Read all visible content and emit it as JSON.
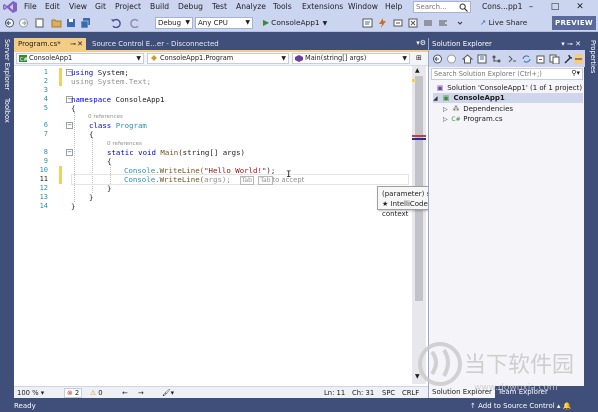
{
  "menu": {
    "items": [
      "File",
      "Edit",
      "View",
      "Git",
      "Project",
      "Build",
      "Debug",
      "Test",
      "Analyze",
      "Tools",
      "Extensions",
      "Window",
      "Help"
    ],
    "search_placeholder": "Search...",
    "solution_title": "Cons...pp1"
  },
  "toolbar": {
    "config": "Debug",
    "platform": "Any CPU",
    "start_label": "ConsoleApp1",
    "live_share": "Live Share",
    "preview": "PREVIEW"
  },
  "side_strip": {
    "left": [
      "Server Explorer",
      "Toolbox"
    ],
    "right": [
      "Properties"
    ]
  },
  "tabs": [
    {
      "label": "Program.cs*",
      "active": true
    },
    {
      "label": "Source Control E...er - Disconnected",
      "active": false
    }
  ],
  "nav": {
    "project": "ConsoleApp1",
    "class": "ConsoleApp1.Program",
    "member": "Main(string[] args)"
  },
  "code": {
    "line_numbers": [
      "1",
      "2",
      "3",
      "4",
      "5",
      "6",
      "7",
      "8",
      "9",
      "10",
      "11",
      "12",
      "13",
      "14"
    ],
    "refs_label": "0 references",
    "l1_kw": "using",
    "l1_rest": " System;",
    "l2": "using System.Text;",
    "l4_kw": "namespace",
    "l4_rest": " ConsoleApp1",
    "l5": "{",
    "l6_kw": "class",
    "l6_type": "Program",
    "l7": "{",
    "l8_kw1": "static",
    "l8_kw2": "void",
    "l8_meth": "Main",
    "l8_rest": "(string[] args)",
    "l9": "{",
    "l10_type": "Console",
    "l10_meth": ".WriteLine(",
    "l10_str": "\"Hello World!\"",
    "l10_end": ");",
    "l11_type": "Console",
    "l11_meth": ".WriteLine(",
    "l11_gray": "args);",
    "tab_hint_1": "Tab",
    "tab_hint_2": "Tab",
    "tab_hint_rest": "to accept",
    "l12": "}",
    "l13": "}",
    "l14": "}"
  },
  "tooltip": {
    "line1": "(parameter) string[] args",
    "line2": "★  IntelliCode suggestion based on this context"
  },
  "editor_status": {
    "zoom": "100 %",
    "errors": "2",
    "warnings": "0",
    "position": "Ln: 11",
    "column": "Ch: 31",
    "spacing": "SPC",
    "line_ending": "CRLF"
  },
  "solution_explorer": {
    "title": "Solution Explorer",
    "search_placeholder": "Search Solution Explorer (Ctrl+;)",
    "solution": "Solution 'ConsoleApp1' (1 of 1 project)",
    "project": "ConsoleApp1",
    "dependencies": "Dependencies",
    "file": "Program.cs",
    "bottom_tabs": [
      "Solution Explorer",
      "Team Explorer"
    ]
  },
  "statusbar": {
    "ready": "Ready",
    "add_to_source": "Add to Source Control"
  },
  "watermark": {
    "brand": "当下软件园",
    "url": "www.downxia.com"
  },
  "colors": {
    "frame": "#3f4f7a",
    "chrome": "#ccd5f0",
    "active_tab": "#f5cc84",
    "keyword": "#0000ff",
    "type": "#2b91af",
    "string": "#a31515",
    "preview_button": "#5a6a9c"
  }
}
